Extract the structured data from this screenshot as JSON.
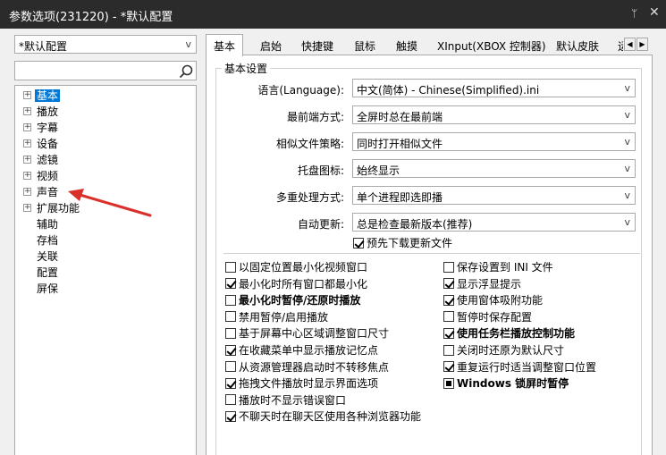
{
  "window": {
    "title": "参数选项(231220) - *默认配置",
    "pin_icon": "pin-icon",
    "close_icon": "close-icon"
  },
  "profile": {
    "value": "*默认配置"
  },
  "search": {
    "placeholder": ""
  },
  "tree": [
    {
      "label": "基本",
      "expandable": true,
      "selected": true
    },
    {
      "label": "播放",
      "expandable": true
    },
    {
      "label": "字幕",
      "expandable": true
    },
    {
      "label": "设备",
      "expandable": true
    },
    {
      "label": "滤镜",
      "expandable": true
    },
    {
      "label": "视频",
      "expandable": true
    },
    {
      "label": "声音",
      "expandable": true
    },
    {
      "label": "扩展功能",
      "expandable": true
    },
    {
      "label": "辅助",
      "expandable": false
    },
    {
      "label": "存档",
      "expandable": false
    },
    {
      "label": "关联",
      "expandable": false
    },
    {
      "label": "配置",
      "expandable": false
    },
    {
      "label": "屏保",
      "expandable": false
    }
  ],
  "tabs": [
    "基本",
    "启始",
    "快捷键",
    "鼠标",
    "触摸",
    "XInput(XBOX 控制器)",
    "默认皮肤",
    "运"
  ],
  "group_title": "基本设置",
  "settings": [
    {
      "label": "语言(Language):",
      "value": "中文(简体) - Chinese(Simplified).ini"
    },
    {
      "label": "最前端方式:",
      "value": "全屏时总在最前端"
    },
    {
      "label": "相似文件策略:",
      "value": "同时打开相似文件"
    },
    {
      "label": "托盘图标:",
      "value": "始终显示"
    },
    {
      "label": "多重处理方式:",
      "value": "单个进程即选即播"
    },
    {
      "label": "自动更新:",
      "value": "总是检查最新版本(推荐)"
    }
  ],
  "predownload": {
    "label": "预先下载更新文件",
    "checked": true
  },
  "left_checks": [
    {
      "label": "以固定位置最小化视频窗口",
      "checked": false
    },
    {
      "label": "最小化时所有窗口都最小化",
      "checked": true
    },
    {
      "label": "最小化时暂停/还原时播放",
      "checked": false,
      "bold": true
    },
    {
      "label": "禁用暂停/启用播放",
      "checked": false
    },
    {
      "label": "基于屏幕中心区域调整窗口尺寸",
      "checked": false
    },
    {
      "label": "在收藏菜单中显示播放记忆点",
      "checked": true
    },
    {
      "label": "从资源管理器启动时不转移焦点",
      "checked": false
    },
    {
      "label": "拖拽文件播放时显示界面选项",
      "checked": true
    },
    {
      "label": "播放时不显示错误窗口",
      "checked": false
    },
    {
      "label": "不聊天时在聊天区使用各种浏览器功能",
      "checked": true
    }
  ],
  "right_checks": [
    {
      "label": "保存设置到 INI 文件",
      "checked": false
    },
    {
      "label": "显示浮显提示",
      "checked": true
    },
    {
      "label": "使用窗体吸附功能",
      "checked": true
    },
    {
      "label": "暂停时保存配置",
      "checked": false
    },
    {
      "label": "使用任务栏播放控制功能",
      "checked": true,
      "bold": true
    },
    {
      "label": "关闭时还原为默认尺寸",
      "checked": false
    },
    {
      "label": "重复运行时适当调整窗口位置",
      "checked": true
    },
    {
      "label": "Windows 锁屏时暂停",
      "mixed": true,
      "bold": true
    }
  ],
  "colors": {
    "titlebar": "#2b2b2b",
    "selection": "#0078d7",
    "annotation_arrow": "#d9302a"
  }
}
